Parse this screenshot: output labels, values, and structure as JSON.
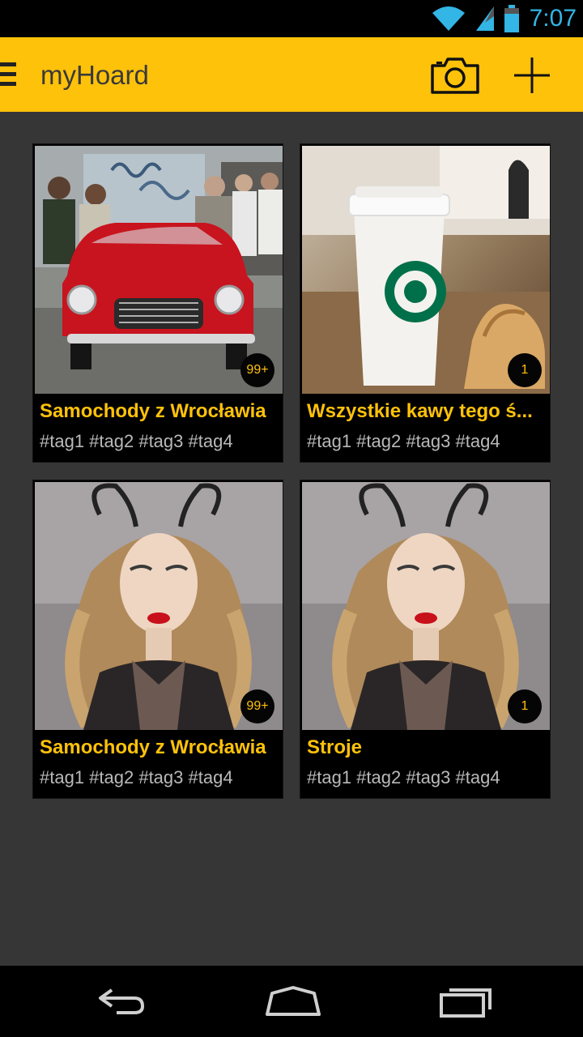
{
  "status_bar": {
    "time": "7:07"
  },
  "action_bar": {
    "title": "myHoard"
  },
  "collections": [
    {
      "title": "Samochody z Wrocławia",
      "tags": "#tag1 #tag2 #tag3 #tag4",
      "count": "99+",
      "image": "red classic car photo"
    },
    {
      "title": "Wszystkie kawy tego ś...",
      "tags": "#tag1 #tag2 #tag3 #tag4",
      "count": "1",
      "image": "coffee cup photo"
    },
    {
      "title": "Samochody z Wrocławia",
      "tags": "#tag1 #tag2 #tag3 #tag4",
      "count": "99+",
      "image": "portrait photo"
    },
    {
      "title": "Stroje",
      "tags": "#tag1 #tag2 #tag3 #tag4",
      "count": "1",
      "image": "portrait photo"
    }
  ],
  "colors": {
    "accent": "#ffc20a",
    "background": "#363636",
    "status_blue": "#33b5e5"
  },
  "icons": [
    "wifi-icon",
    "signal-icon",
    "battery-icon",
    "menu-icon",
    "camera-icon",
    "add-icon",
    "back-icon",
    "home-icon",
    "recents-icon"
  ]
}
